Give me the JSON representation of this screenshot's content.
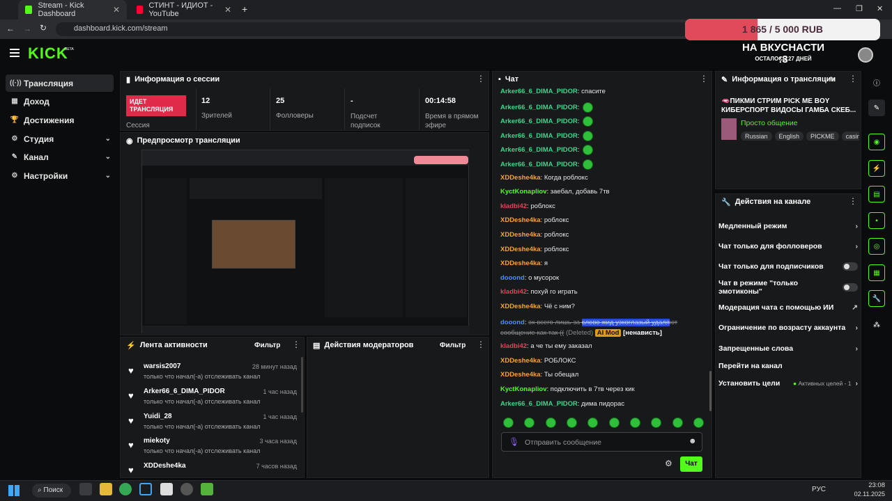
{
  "browser": {
    "tabs": [
      {
        "title": "Stream - Kick Dashboard",
        "close": "✕"
      },
      {
        "title": "СТИНТ - ИДИОТ - YouTube",
        "close": "✕"
      }
    ],
    "new_tab": "+",
    "url": "dashboard.kick.com/stream",
    "window_controls": [
      "—",
      "❐",
      "✕"
    ]
  },
  "header": {
    "logo": "KICK",
    "logo_beta": "BETA",
    "donation_goal": "1 865 / 5 000 RUB",
    "goal_fraction": 0.373,
    "stream_title": "НА ВКУСНАСТИ :3",
    "days_left": "ОСТАЛОСЬ 27 ДНЕЙ"
  },
  "sidebar": {
    "items": [
      {
        "label": "Трансляция",
        "icon": "((·))"
      },
      {
        "label": "Доход",
        "icon": "▦"
      },
      {
        "label": "Достижения",
        "icon": "🏆"
      },
      {
        "label": "Студия",
        "icon": "⚙"
      },
      {
        "label": "Канал",
        "icon": "✎"
      },
      {
        "label": "Настройки",
        "icon": "⚙"
      }
    ],
    "chevron": "⌄"
  },
  "session": {
    "title": "Информация о сессии",
    "live_label": "ИДЕТ ТРАНСЛЯЦИЯ",
    "session_label": "Сессия",
    "stats": [
      {
        "value": "12",
        "label": "Зрителей"
      },
      {
        "value": "25",
        "label": "Фолловеры"
      },
      {
        "value": "-",
        "label": "Подсчет подписок"
      },
      {
        "value": "00:14:58",
        "label": "Время в прямом эфире"
      }
    ]
  },
  "preview": {
    "title": "Предпросмотр трансляции"
  },
  "activity": {
    "title": "Лента активности",
    "filter": "Фильтр",
    "items": [
      {
        "name": "warsis2007",
        "time": "28 минут назад",
        "desc": "только что начал(-а) отслеживать канал"
      },
      {
        "name": "Arker66_6_DIMA_PIDOR",
        "time": "1 час назад",
        "desc": "только что начал(-а) отслеживать канал"
      },
      {
        "name": "Yuidi_28",
        "time": "1 час назад",
        "desc": "только что начал(-а) отслеживать канал"
      },
      {
        "name": "miekoty",
        "time": "3 часа назад",
        "desc": "только что начал(-а) отслеживать канал"
      },
      {
        "name": "XDDeshe4ka",
        "time": "7 часов назад",
        "desc": ""
      }
    ]
  },
  "moderators": {
    "title": "Действия модераторов",
    "filter": "Фильтр"
  },
  "chat": {
    "title": "Чат",
    "messages": [
      {
        "user": "Arker66_6_DIMA_PIDOR",
        "text": "спасите",
        "color": "teal",
        "emotes": 0
      },
      {
        "user": "Arker66_6_DIMA_PIDOR",
        "text": "",
        "color": "teal",
        "emotes": 1
      },
      {
        "user": "Arker66_6_DIMA_PIDOR",
        "text": "",
        "color": "teal",
        "emotes": 1
      },
      {
        "user": "Arker66_6_DIMA_PIDOR",
        "text": "",
        "color": "teal",
        "emotes": 1
      },
      {
        "user": "Arker66_6_DIMA_PIDOR",
        "text": "",
        "color": "teal",
        "emotes": 1
      },
      {
        "user": "Arker66_6_DIMA_PIDOR",
        "text": "",
        "color": "teal",
        "emotes": 1
      },
      {
        "user": "XDDeshe4ka",
        "text": "Когда роблокс",
        "color": "orange",
        "emotes": 0
      },
      {
        "user": "KyctKonapliov",
        "text": "заебал, добавь 7тв",
        "color": "green",
        "emotes": 0
      },
      {
        "user": "kladbi42",
        "text": "роблокс",
        "color": "red",
        "emotes": 0
      },
      {
        "user": "XDDeshe4ka",
        "text": "роблокс",
        "color": "orange",
        "emotes": 0
      },
      {
        "user": "XDDeshe4ka",
        "text": "роблокс",
        "color": "orange",
        "emotes": 0
      },
      {
        "user": "XDDeshe4ka",
        "text": "роблокс",
        "color": "orange",
        "emotes": 0
      },
      {
        "user": "XDDeshe4ka",
        "text": "я",
        "color": "orange",
        "emotes": 0
      },
      {
        "user": "dooond",
        "text": "о мусорок",
        "color": "blue",
        "emotes": 0
      },
      {
        "user": "kladbi42",
        "text": "похуй го играть",
        "color": "red",
        "emotes": 0
      },
      {
        "user": "XDDeshe4ka",
        "text": "Чё с ним?",
        "color": "orange",
        "emotes": 0
      }
    ],
    "deleted": {
      "user": "dooond",
      "text_a": "эх всего лишь за ",
      "text_hl": "слово жид узкоглазый удаля",
      "text_b": "ют",
      "line2": "сообщение как так ((",
      "deleted_label": "(Deleted)",
      "badge": "AI Mod",
      "reason": "[ненависть]"
    },
    "messages2": [
      {
        "user": "kladbi42",
        "text": "а че ты ему заказал",
        "color": "red"
      },
      {
        "user": "XDDeshe4ka",
        "text": "РОБЛОКС",
        "color": "orange"
      },
      {
        "user": "XDDeshe4ka",
        "text": "Ты обещал",
        "color": "orange"
      },
      {
        "user": "KyctKonapliov",
        "text": "подключить в 7тв через кик",
        "color": "green"
      },
      {
        "user": "Arker66_6_DIMA_PIDOR",
        "text": "дима пидорас",
        "color": "teal"
      }
    ],
    "emote_count": 10,
    "input_placeholder": "Отправить сообщение",
    "send": "Чат"
  },
  "stream_info": {
    "title": "Информация о трансляции",
    "stream_name": "🫦ПИКМИ СТРИМ PICK ME BOY КИБЕРСПОРТ ВИДОСЫ ГАМБА СКЕБ...",
    "category": "Просто общение",
    "tags": [
      "Russian",
      "English",
      "PICKME",
      "casin"
    ]
  },
  "channel_actions": {
    "title": "Действия на канале",
    "items": [
      {
        "label": "Медленный режим",
        "right": "›"
      },
      {
        "label": "Чат только для фолловеров",
        "right": "›"
      },
      {
        "label": "Чат только для подписчиков",
        "right": "toggle"
      },
      {
        "label": "Чат в режиме \"только эмотиконы\"",
        "right": "toggle"
      },
      {
        "label": "Модерация чата с помощью ИИ",
        "right": "↗"
      },
      {
        "label": "Ограничение по возрасту аккаунта",
        "right": "›"
      },
      {
        "label": "Запрещенные слова",
        "right": "›"
      },
      {
        "label": "Перейти на канал",
        "right": ""
      },
      {
        "label": "Установить цели",
        "right": "›",
        "extra": "Активных целей - 1"
      }
    ]
  },
  "taskbar": {
    "search": "Поиск",
    "lang": "РУС",
    "time": "23:08",
    "date": "02.11.2025"
  }
}
